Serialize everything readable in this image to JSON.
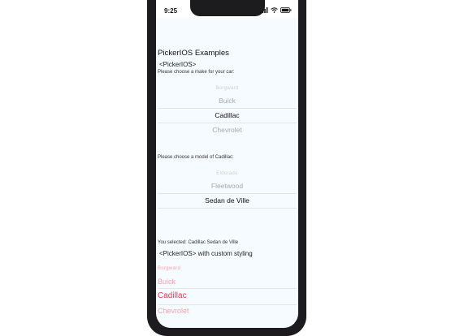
{
  "status_bar": {
    "time": "9:25",
    "icons": [
      "signal-icon",
      "wifi-icon",
      "battery-icon"
    ]
  },
  "header": {
    "title": "PickerIOS Examples",
    "subtitle": "<PickerIOS>"
  },
  "make_picker": {
    "prompt": "Please choose a make for your car:",
    "items": [
      "Borgward",
      "Buick",
      "Cadillac",
      "Chevrolet"
    ],
    "selected": "Cadillac"
  },
  "model_picker": {
    "prompt": "Please choose a model of Cadillac:",
    "items": [
      "Eldorado",
      "Fleetwood",
      "Sedan de Ville"
    ],
    "selected": "Sedan de Ville"
  },
  "selection": {
    "text": "You selected: Cadillac Sedan de Ville"
  },
  "custom_picker": {
    "title": "<PickerIOS> with custom styling",
    "items": [
      "Borgward",
      "Buick",
      "Cadillac",
      "Chevrolet"
    ],
    "selected": "Cadillac",
    "colors": {
      "selected": "#e83a4a",
      "unselected": "#f4a3ad"
    }
  },
  "colors": {
    "screen_background": "#f5fbff",
    "device_frame": "#1c1c1e"
  }
}
